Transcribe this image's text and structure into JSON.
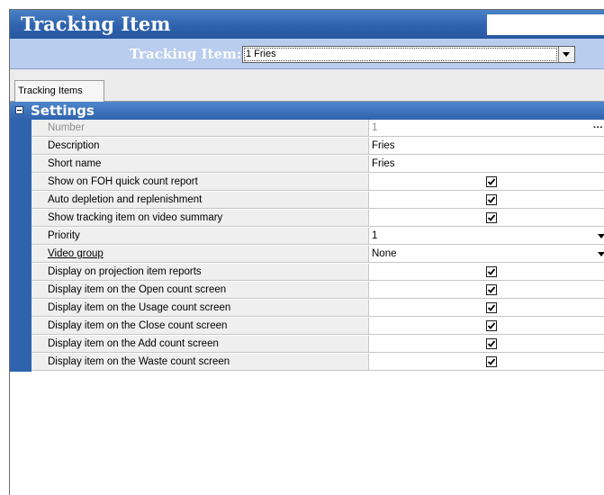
{
  "window": {
    "title": "Tracking Item"
  },
  "selector": {
    "label": "Tracking Item:",
    "value": "1 Fries"
  },
  "tabs": [
    {
      "label": "Tracking Items"
    }
  ],
  "section": {
    "title": "Settings"
  },
  "rows": [
    {
      "label": "Number",
      "value": "1",
      "type": "text",
      "disabled": true,
      "ellipsis": true
    },
    {
      "label": "Description",
      "value": "Fries",
      "type": "text"
    },
    {
      "label": "Short name",
      "value": "Fries",
      "type": "text"
    },
    {
      "label": "Show on FOH quick count report",
      "type": "checkbox",
      "checked": true
    },
    {
      "label": "Auto depletion and replenishment",
      "type": "checkbox",
      "checked": true
    },
    {
      "label": "Show tracking item on video summary",
      "type": "checkbox",
      "checked": true
    },
    {
      "label": "Priority",
      "value": "1",
      "type": "dropdown"
    },
    {
      "label": "Video group",
      "value": "None",
      "type": "dropdown",
      "link": true
    },
    {
      "label": "Display on projection item reports",
      "type": "checkbox",
      "checked": true
    },
    {
      "label": "Display item on the Open count screen",
      "type": "checkbox",
      "checked": true
    },
    {
      "label": "Display item on the Usage count screen",
      "type": "checkbox",
      "checked": true
    },
    {
      "label": "Display item on the Close count screen",
      "type": "checkbox",
      "checked": true
    },
    {
      "label": "Display item on the Add count screen",
      "type": "checkbox",
      "checked": true
    },
    {
      "label": "Display item on the Waste count screen",
      "type": "checkbox",
      "checked": true
    }
  ],
  "colors": {
    "title_blue": "#2f63ad",
    "selector_bg": "#b9cdee",
    "label_bg": "#efefef"
  }
}
